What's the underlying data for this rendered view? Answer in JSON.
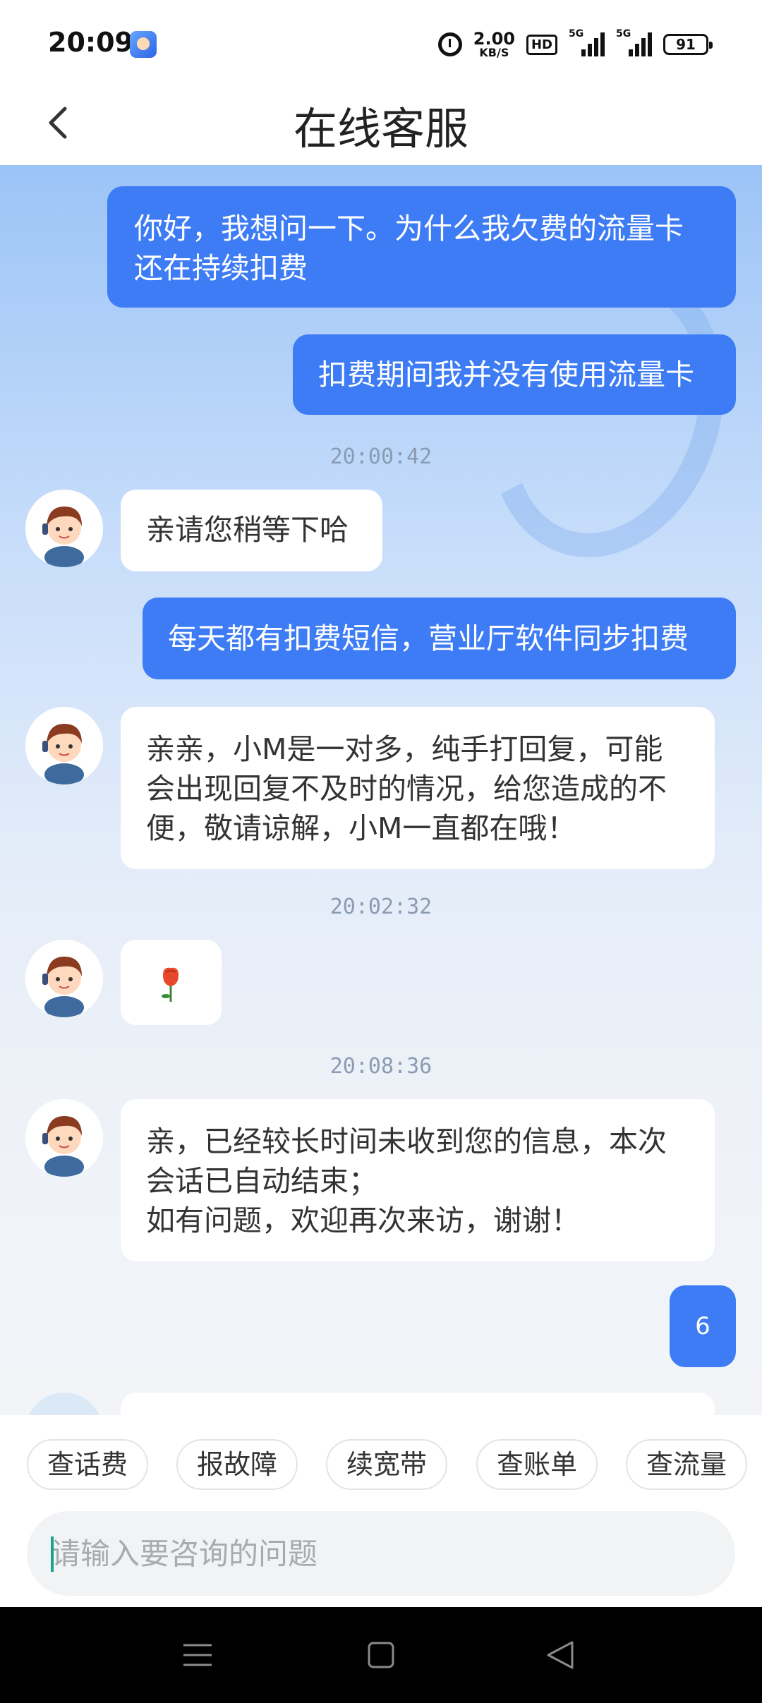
{
  "status_bar": {
    "time": "20:09",
    "speed_value": "2.00",
    "speed_unit": "KB/S",
    "hd": "HD",
    "signal1_label": "5G",
    "signal2_label": "5G",
    "battery": "91",
    "icons": [
      "app-icon",
      "alarm-icon",
      "hd-icon",
      "signal-icon",
      "battery-icon"
    ]
  },
  "header": {
    "title": "在线客服",
    "back_icon": "chevron-left-icon"
  },
  "chat": {
    "messages": [
      {
        "from": "user",
        "text": "你好，我想问一下。为什么我欠费的流量卡\n还在持续扣费"
      },
      {
        "from": "user",
        "text": "扣费期间我并没有使用流量卡"
      },
      {
        "type": "timestamp",
        "text": "20:00:42"
      },
      {
        "from": "agent",
        "text": "亲请您稍等下哈"
      },
      {
        "from": "user",
        "text": "每天都有扣费短信，营业厅软件同步扣费"
      },
      {
        "from": "agent",
        "text": "亲亲，小M是一对多，纯手打回复，可能\n会出现回复不及时的情况，给您造成的不\n便，敬请谅解，小M一直都在哦！"
      },
      {
        "type": "timestamp",
        "text": "20:02:32"
      },
      {
        "from": "agent",
        "text": "🌹",
        "icon": "rose-icon"
      },
      {
        "type": "timestamp",
        "text": "20:08:36"
      },
      {
        "from": "agent",
        "text": "亲，已经较长时间未收到您的信息，本次\n会话已自动结束；\n如有问题，欢迎再次来访，谢谢！"
      },
      {
        "from": "user",
        "text": "6"
      }
    ]
  },
  "quick_actions": [
    "查话费",
    "报故障",
    "续宽带",
    "查账单",
    "查流量"
  ],
  "input": {
    "placeholder": "请输入要咨询的问题",
    "value": ""
  },
  "nav_bar": {
    "icons": [
      "menu-icon",
      "home-icon",
      "back-icon"
    ]
  },
  "colors": {
    "user_bubble": "#3d7cf5",
    "agent_bubble": "#ffffff",
    "timestamp": "#8a9bb3",
    "chat_bg_top": "#9cc4f7"
  }
}
